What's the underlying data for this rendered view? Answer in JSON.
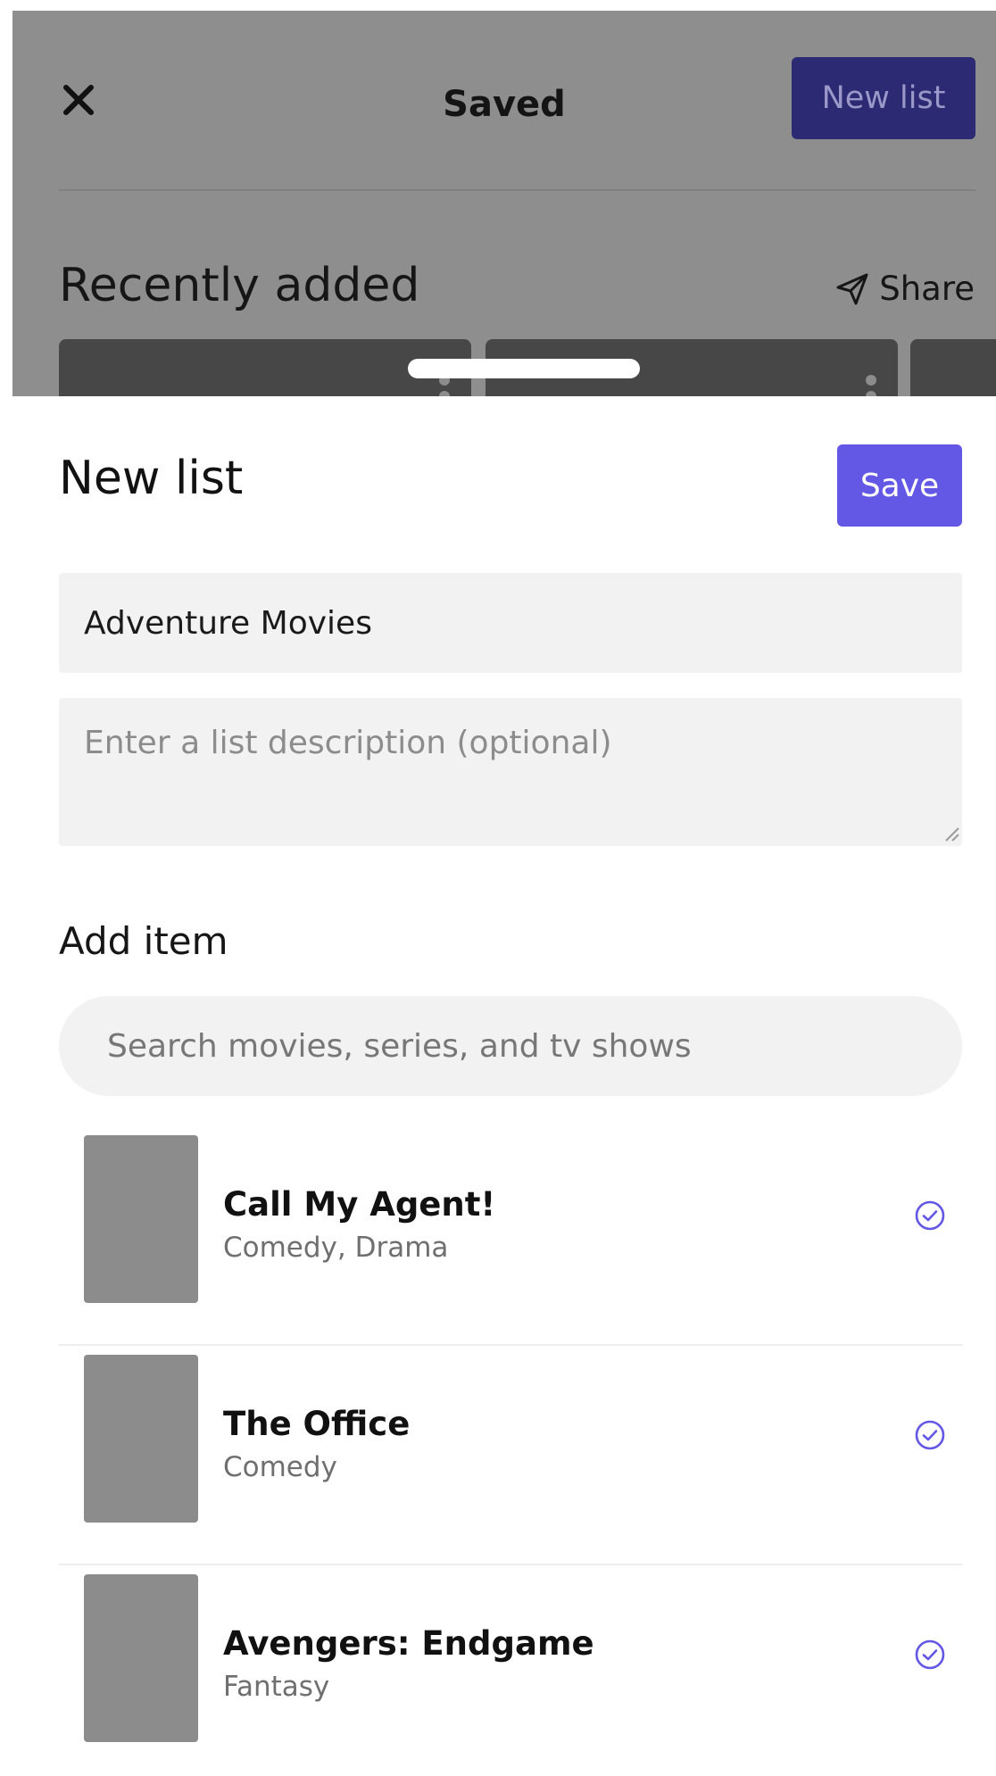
{
  "background_screen": {
    "title": "Saved",
    "new_list_button": "New list",
    "section_title": "Recently added",
    "share_label": "Share"
  },
  "sheet": {
    "title": "New list",
    "save_button": "Save",
    "name_value": "Adventure Movies",
    "description_placeholder": "Enter a list description (optional)",
    "add_item_label": "Add item",
    "search_placeholder": "Search movies, series, and tv shows",
    "results": [
      {
        "title": "Call My Agent!",
        "genre": "Comedy, Drama",
        "added": true
      },
      {
        "title": "The Office",
        "genre": "Comedy",
        "added": true
      },
      {
        "title": "Avengers: Endgame",
        "genre": "Fantasy",
        "added": true
      }
    ]
  },
  "colors": {
    "accent": "#6357e6",
    "accent_dimmed": "#2b2a72",
    "overlay": "#8e8e8e",
    "field_bg": "#f2f2f2",
    "poster_placeholder": "#8c8c8c"
  },
  "icons": [
    "close-icon",
    "send-icon",
    "check-circle-icon",
    "resize-grip-icon"
  ]
}
